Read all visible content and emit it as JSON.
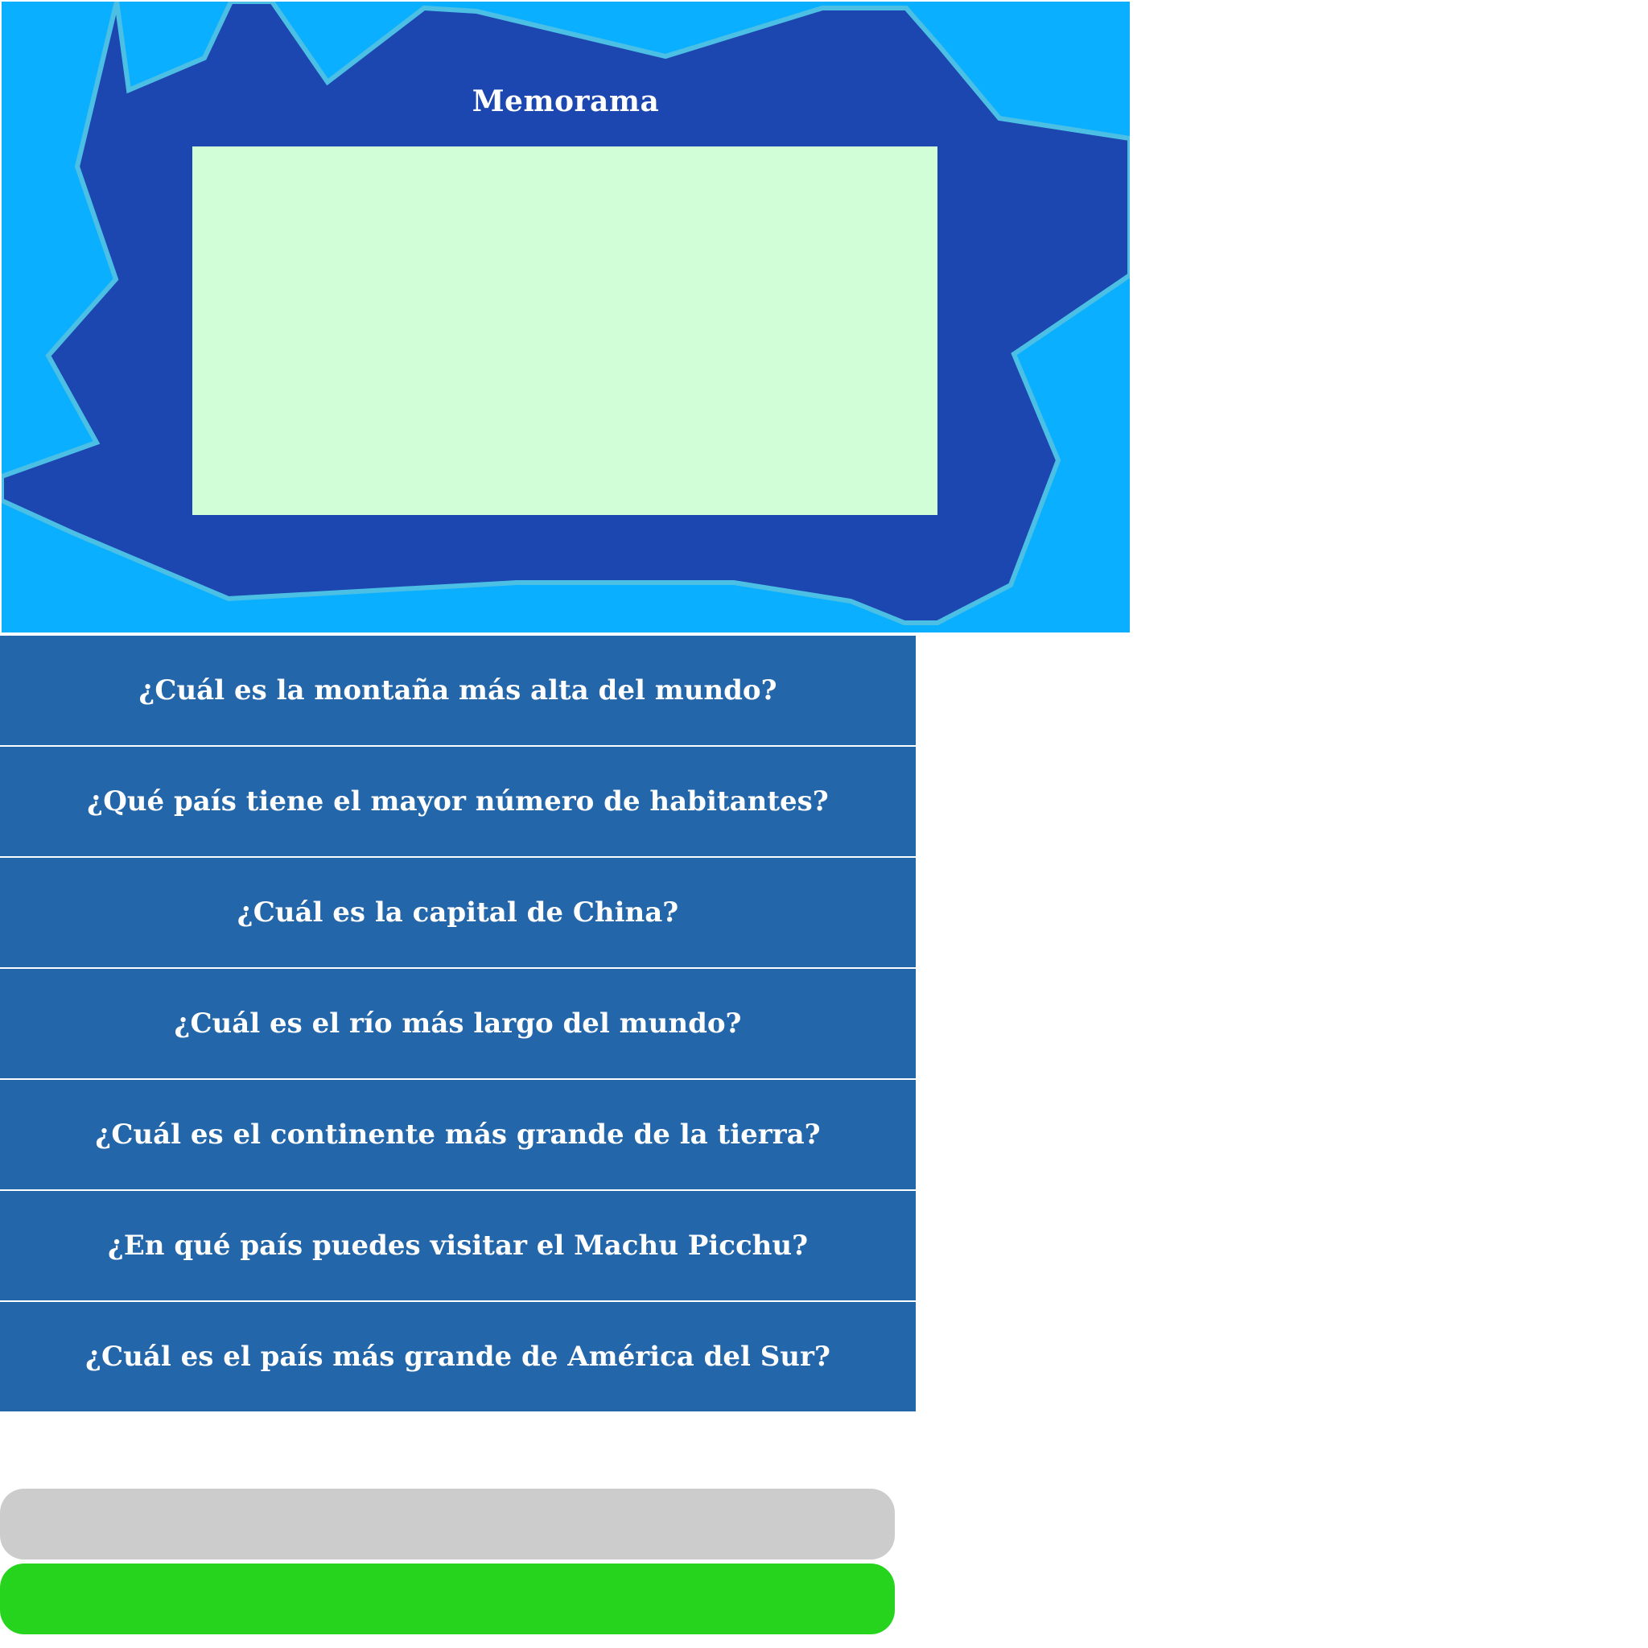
{
  "board": {
    "title": "Memorama",
    "colors": {
      "background": "#0aafff",
      "frame": "#1c47b0",
      "outline": "#4cc0e4",
      "play_area": "#d1fed7"
    }
  },
  "questions": [
    {
      "label": "¿Cuál es la montaña más alta del mundo?"
    },
    {
      "label": "¿Qué país tiene el mayor número de habitantes?"
    },
    {
      "label": "¿Cuál es la capital de China?"
    },
    {
      "label": "¿Cuál es el río más largo del mundo?"
    },
    {
      "label": "¿Cuál es el continente más grande de la tierra?"
    },
    {
      "label": "¿En qué país puedes visitar el Machu Picchu?"
    },
    {
      "label": "¿Cuál es el país más grande de América del Sur?"
    }
  ],
  "question_color": "#2366a9",
  "bars": {
    "grey": "#cccccc",
    "green": "#27d41d"
  }
}
